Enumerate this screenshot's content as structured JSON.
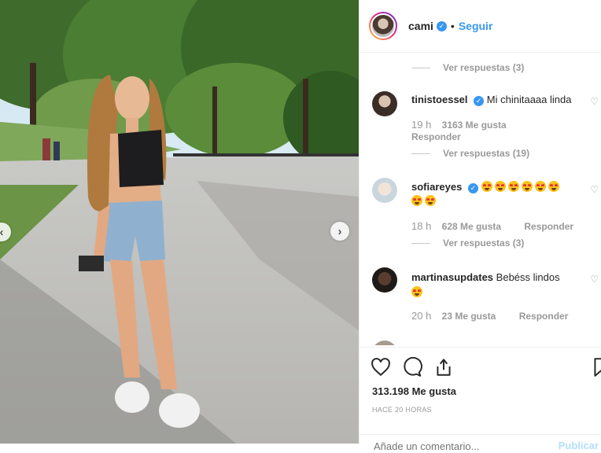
{
  "post": {
    "username": "cami",
    "separator": "•",
    "follow_label": "Seguir",
    "likes": "313.198 Me gusta",
    "posted_time": "HACE 20 HORAS",
    "add_comment_placeholder": "Añade un comentario...",
    "publish_label": "Publicar"
  },
  "comments": {
    "top_replies": "Ver respuestas (3)",
    "items": [
      {
        "username": "tinistoessel",
        "text": "Mi chinitaaaa linda",
        "time": "19 h",
        "likes": "3163 Me gusta",
        "reply_label": "Responder",
        "replies": "Ver respuestas (19)"
      },
      {
        "username": "sofiareyes",
        "emoji_count": 8,
        "emoji_name": "heart-eyes-emoji",
        "time": "18 h",
        "likes": "628 Me gusta",
        "reply_label": "Responder",
        "replies": "Ver respuestas (3)"
      },
      {
        "username": "martinasupdates",
        "text": "Bebéss lindos",
        "emoji_count": 1,
        "time": "20 h",
        "likes": "23 Me gusta",
        "reply_label": "Responder"
      }
    ]
  },
  "colors": {
    "accent": "#3897f0",
    "muted": "#999999",
    "border": "#efefef"
  },
  "icons": [
    "heart-icon",
    "comment-icon",
    "share-icon",
    "bookmark-icon",
    "chevron-right-icon",
    "chevron-left-icon",
    "verified-badge-icon"
  ]
}
